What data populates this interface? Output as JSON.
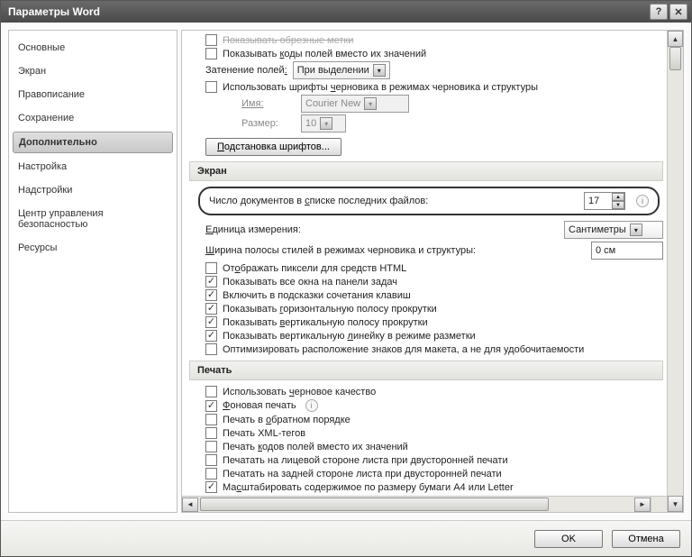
{
  "title": "Параметры Word",
  "nav": {
    "items": [
      {
        "label": "Основные"
      },
      {
        "label": "Экран"
      },
      {
        "label": "Правописание"
      },
      {
        "label": "Сохранение"
      },
      {
        "label": "Дополнительно"
      },
      {
        "label": "Настройка"
      },
      {
        "label": "Надстройки"
      },
      {
        "label": "Центр управления безопасностью"
      },
      {
        "label": "Ресурсы"
      }
    ],
    "active": 4
  },
  "top": {
    "cut_line": "Показывать обрезные метки",
    "show_field_codes": "Показывать коды полей вместо их значений",
    "shading_label": "Затенение полей:",
    "shading_value": "При выделении",
    "use_draft_fonts": "Использовать шрифты черновика в режимах черновика и структуры",
    "name_label": "Имя:",
    "name_value": "Courier New",
    "size_label": "Размер:",
    "size_value": "10",
    "font_sub_btn": "Подстановка шрифтов..."
  },
  "screen": {
    "heading": "Экран",
    "recent_label": "Число документов в списке последних файлов:",
    "recent_value": "17",
    "unit_label": "Единица измерения:",
    "unit_value": "Сантиметры",
    "style_width_label": "Ширина полосы стилей в режимах черновика и структуры:",
    "style_width_value": "0 см",
    "chk1": "Отображать пиксели для средств HTML",
    "chk2": "Показывать все окна на панели задач",
    "chk3": "Включить в подсказки сочетания клавиш",
    "chk4": "Показывать горизонтальную полосу прокрутки",
    "chk5": "Показывать вертикальную полосу прокрутки",
    "chk6": "Показывать вертикальную линейку в режиме разметки",
    "chk7": "Оптимизировать расположение знаков для макета, а не для удобочитаемости"
  },
  "print": {
    "heading": "Печать",
    "p1": "Использовать черновое качество",
    "p2": "Фоновая печать",
    "p3": "Печать в обратном порядке",
    "p4": "Печать XML-тегов",
    "p5": "Печать кодов полей вместо их значений",
    "p6": "Печатать на лицевой стороне листа при двусторонней печати",
    "p7": "Печатать на задней стороне листа при двусторонней печати",
    "p8": "Масштабировать содержимое по размеру бумаги A4 или Letter"
  },
  "footer": {
    "ok": "OK",
    "cancel": "Отмена"
  }
}
